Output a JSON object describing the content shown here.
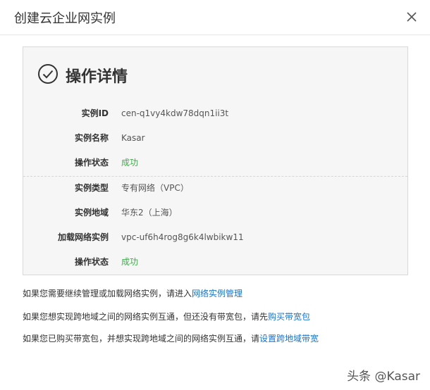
{
  "dialog": {
    "title": "创建云企业网实例",
    "close_icon": "close-icon"
  },
  "panel": {
    "check_icon": "check-circle-icon",
    "title": "操作详情",
    "rows": [
      {
        "label": "实例ID",
        "value": "cen-q1vy4kdw78dqn1ii3t",
        "status": false
      },
      {
        "label": "实例名称",
        "value": "Kasar",
        "status": false
      },
      {
        "label": "操作状态",
        "value": "成功",
        "status": true
      },
      {
        "label": "实例类型",
        "value": "专有网络（VPC）",
        "status": false
      },
      {
        "label": "实例地域",
        "value": "华东2（上海）",
        "status": false
      },
      {
        "label": "加载网络实例",
        "value": "vpc-uf6h4rog8g6k4lwbikw11",
        "status": false
      },
      {
        "label": "操作状态",
        "value": "成功",
        "status": true
      }
    ],
    "success_color": "#3fa94c"
  },
  "notes": [
    {
      "text": "如果您需要继续管理或加载网络实例，请进入",
      "link": "网络实例管理"
    },
    {
      "text": "如果您想实现跨地域之间的网络实例互通，但还没有带宽包，请先",
      "link": "购买带宽包"
    },
    {
      "text": "如果您已购买带宽包，并想实现跨地域之间的网络实例互通，请",
      "link": "设置跨地域带宽"
    }
  ],
  "link_color": "#1a73c8",
  "watermark": "头条 @Kasar"
}
